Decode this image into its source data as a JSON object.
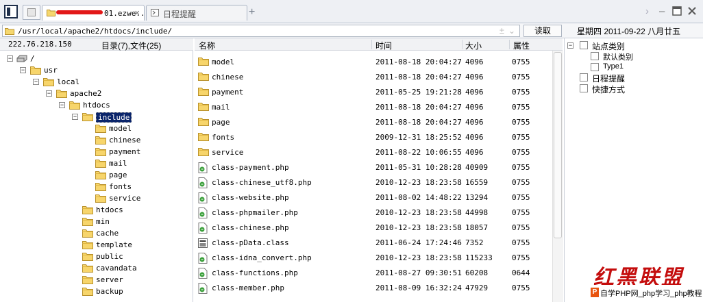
{
  "tabs": [
    {
      "label": "01.ezwe...",
      "active": true,
      "icon": "folder-icon"
    },
    {
      "label": "日程提醒",
      "active": false,
      "icon": "calendar-icon"
    }
  ],
  "address": {
    "path": "/usr/local/apache2/htdocs/include/",
    "read_button": "读取",
    "date": "星期四 2011-09-22 八月廿五"
  },
  "left": {
    "ip": "222.76.218.150",
    "counts": "目录(7),文件(25)",
    "tree": [
      {
        "label": "/",
        "level": 0,
        "toggle": "−",
        "icon": "drive-icon"
      },
      {
        "label": "usr",
        "level": 1,
        "toggle": "−",
        "icon": "folder-icon"
      },
      {
        "label": "local",
        "level": 2,
        "toggle": "−",
        "icon": "folder-icon"
      },
      {
        "label": "apache2",
        "level": 3,
        "toggle": "−",
        "icon": "folder-icon"
      },
      {
        "label": "htdocs",
        "level": 4,
        "toggle": "−",
        "icon": "folder-icon"
      },
      {
        "label": "include",
        "level": 5,
        "toggle": "−",
        "icon": "folder-icon",
        "selected": true
      },
      {
        "label": "model",
        "level": 6,
        "toggle": "",
        "icon": "folder-icon"
      },
      {
        "label": "chinese",
        "level": 6,
        "toggle": "",
        "icon": "folder-icon"
      },
      {
        "label": "payment",
        "level": 6,
        "toggle": "",
        "icon": "folder-icon"
      },
      {
        "label": "mail",
        "level": 6,
        "toggle": "",
        "icon": "folder-icon"
      },
      {
        "label": "page",
        "level": 6,
        "toggle": "",
        "icon": "folder-icon"
      },
      {
        "label": "fonts",
        "level": 6,
        "toggle": "",
        "icon": "folder-icon"
      },
      {
        "label": "service",
        "level": 6,
        "toggle": "",
        "icon": "folder-icon"
      },
      {
        "label": "htdocs",
        "level": 5,
        "toggle": "",
        "icon": "folder-icon"
      },
      {
        "label": "min",
        "level": 5,
        "toggle": "",
        "icon": "folder-icon"
      },
      {
        "label": "cache",
        "level": 5,
        "toggle": "",
        "icon": "folder-icon"
      },
      {
        "label": "template",
        "level": 5,
        "toggle": "",
        "icon": "folder-icon"
      },
      {
        "label": "public",
        "level": 5,
        "toggle": "",
        "icon": "folder-icon"
      },
      {
        "label": "cavandata",
        "level": 5,
        "toggle": "",
        "icon": "folder-icon"
      },
      {
        "label": "server",
        "level": 5,
        "toggle": "",
        "icon": "folder-icon"
      },
      {
        "label": "backup",
        "level": 5,
        "toggle": "",
        "icon": "folder-icon"
      }
    ]
  },
  "files": {
    "headers": {
      "name": "名称",
      "time": "时间",
      "size": "大小",
      "attr": "属性"
    },
    "rows": [
      {
        "name": "model",
        "time": "2011-08-18 20:04:27",
        "size": "4096",
        "attr": "0755",
        "icon": "folder-icon"
      },
      {
        "name": "chinese",
        "time": "2011-08-18 20:04:27",
        "size": "4096",
        "attr": "0755",
        "icon": "folder-icon"
      },
      {
        "name": "payment",
        "time": "2011-05-25 19:21:28",
        "size": "4096",
        "attr": "0755",
        "icon": "folder-icon"
      },
      {
        "name": "mail",
        "time": "2011-08-18 20:04:27",
        "size": "4096",
        "attr": "0755",
        "icon": "folder-icon"
      },
      {
        "name": "page",
        "time": "2011-08-18 20:04:27",
        "size": "4096",
        "attr": "0755",
        "icon": "folder-icon"
      },
      {
        "name": "fonts",
        "time": "2009-12-31 18:25:52",
        "size": "4096",
        "attr": "0755",
        "icon": "folder-icon"
      },
      {
        "name": "service",
        "time": "2011-08-22 10:06:55",
        "size": "4096",
        "attr": "0755",
        "icon": "folder-icon"
      },
      {
        "name": "class-payment.php",
        "time": "2011-05-31 10:28:28",
        "size": "40909",
        "attr": "0755",
        "icon": "php-file-icon"
      },
      {
        "name": "class-chinese_utf8.php",
        "time": "2010-12-23 18:23:58",
        "size": "16559",
        "attr": "0755",
        "icon": "php-file-icon"
      },
      {
        "name": "class-website.php",
        "time": "2011-08-02 14:48:22",
        "size": "13294",
        "attr": "0755",
        "icon": "php-file-icon"
      },
      {
        "name": "class-phpmailer.php",
        "time": "2010-12-23 18:23:58",
        "size": "44998",
        "attr": "0755",
        "icon": "php-file-icon"
      },
      {
        "name": "class-chinese.php",
        "time": "2010-12-23 18:23:58",
        "size": "18057",
        "attr": "0755",
        "icon": "php-file-icon"
      },
      {
        "name": "class-pData.class",
        "time": "2011-06-24 17:24:46",
        "size": "7352",
        "attr": "0755",
        "icon": "class-file-icon"
      },
      {
        "name": "class-idna_convert.php",
        "time": "2010-12-23 18:23:58",
        "size": "115233",
        "attr": "0755",
        "icon": "php-file-icon"
      },
      {
        "name": "class-functions.php",
        "time": "2011-08-27 09:30:51",
        "size": "60208",
        "attr": "0644",
        "icon": "php-file-icon"
      },
      {
        "name": "class-member.php",
        "time": "2011-08-09 16:32:24",
        "size": "47929",
        "attr": "0755",
        "icon": "php-file-icon"
      }
    ]
  },
  "right": {
    "items": [
      {
        "label": "站点类别",
        "level": 0,
        "toggle": "−",
        "icon": "category-icon"
      },
      {
        "label": "默认类别",
        "level": 1,
        "toggle": "",
        "icon": "page-icon"
      },
      {
        "label": "Type1",
        "level": 1,
        "toggle": "",
        "icon": "page-icon"
      },
      {
        "label": "日程提醒",
        "level": 0,
        "toggle": "",
        "icon": "calendar-icon"
      },
      {
        "label": "快捷方式",
        "level": 0,
        "toggle": "",
        "icon": "shortcut-icon"
      }
    ]
  },
  "watermark": {
    "title": "红黑联盟",
    "logo": "P",
    "footer": "自学PHP网_php学习_php教程"
  }
}
